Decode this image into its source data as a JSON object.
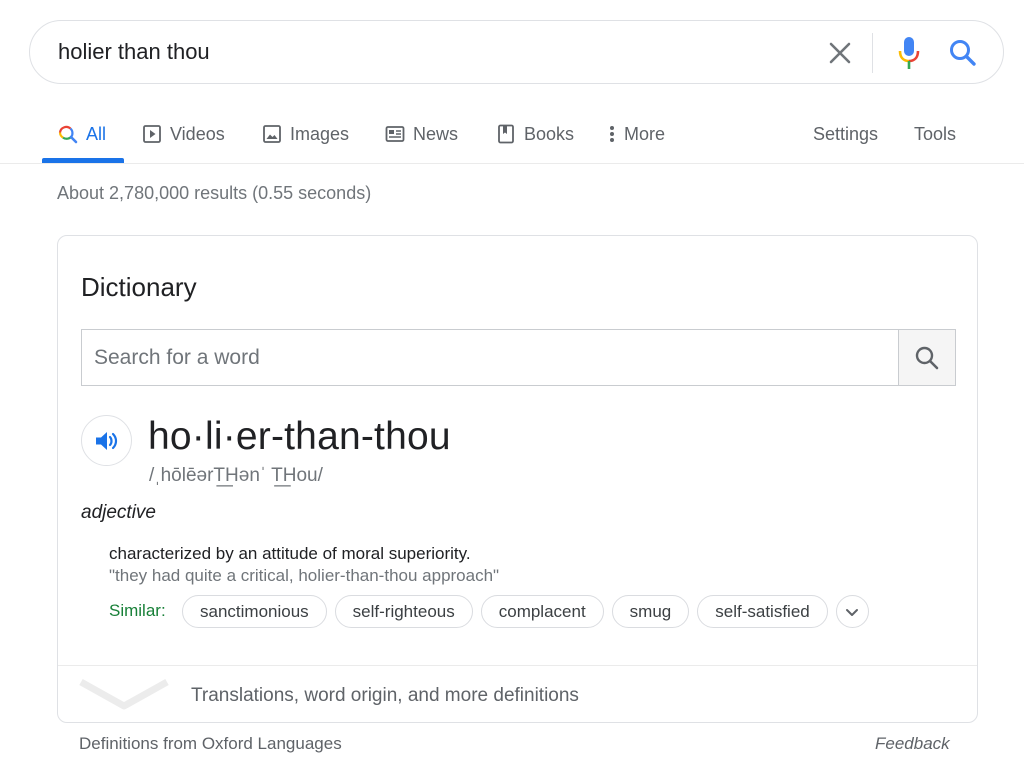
{
  "search": {
    "query": "holier than thou",
    "icons": {
      "clear": "close-icon",
      "voice": "microphone-icon",
      "submit": "search-icon"
    }
  },
  "tabs": [
    {
      "label": "All",
      "icon": "search-icon",
      "active": true
    },
    {
      "label": "Videos",
      "icon": "play-icon"
    },
    {
      "label": "Images",
      "icon": "image-icon"
    },
    {
      "label": "News",
      "icon": "news-icon"
    },
    {
      "label": "Books",
      "icon": "book-icon"
    },
    {
      "label": "More",
      "icon": "more-vert-icon"
    }
  ],
  "tools": {
    "settings": "Settings",
    "tools": "Tools"
  },
  "result_stats": "About 2,780,000 results (0.55 seconds)",
  "dictionary": {
    "title": "Dictionary",
    "search_placeholder": "Search for a word",
    "headword": "ho·li·er-than-thou",
    "phonetic": "/ˌhōlēərT͟Hənˈ T͟Hou/",
    "part_of_speech": "adjective",
    "definition": "characterized by an attitude of moral superiority.",
    "example": "\"they had quite a critical, holier-than-thou approach\"",
    "similar_label": "Similar:",
    "similar": [
      "sanctimonious",
      "self-righteous",
      "complacent",
      "smug",
      "self-satisfied"
    ],
    "more_link": "Translations, word origin, and more definitions"
  },
  "footer": {
    "source": "Definitions from Oxford Languages",
    "feedback": "Feedback"
  },
  "colors": {
    "accent": "#1a73e8",
    "similar_label": "#188038",
    "mic_red": "#ea4335",
    "mic_yellow": "#fbbc04",
    "mic_green": "#34a853"
  }
}
